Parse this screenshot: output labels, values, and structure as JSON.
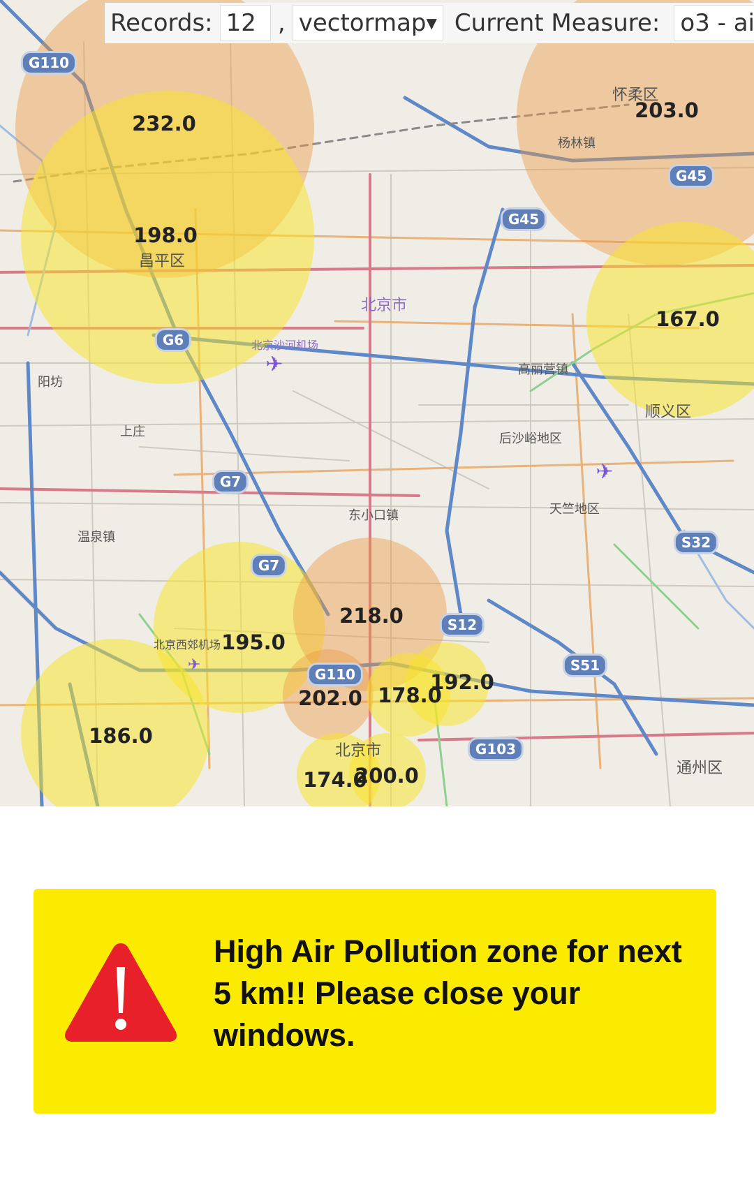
{
  "toolbar": {
    "records_label": "Records:",
    "records_value": "12",
    "separator": ",",
    "layer_selected": "vectormap",
    "measure_label": "Current Measure:",
    "measure_value": "o3 - ai"
  },
  "map": {
    "zones": [
      {
        "value": "232.0",
        "level": "orange",
        "color": "#ec9840"
      },
      {
        "value": "198.0",
        "level": "yellow",
        "color": "#f8e428"
      },
      {
        "value": "203.0",
        "level": "orange",
        "color": "#ec9840"
      },
      {
        "value": "167.0",
        "level": "yellow",
        "color": "#f8e428"
      },
      {
        "value": "218.0",
        "level": "orange",
        "color": "#ec9840"
      },
      {
        "value": "195.0",
        "level": "yellow",
        "color": "#f8e428"
      },
      {
        "value": "202.0",
        "level": "orange",
        "color": "#ec9840"
      },
      {
        "value": "178.0",
        "level": "yellow",
        "color": "#f8e428"
      },
      {
        "value": "192.0",
        "level": "yellow",
        "color": "#f8e428"
      },
      {
        "value": "186.0",
        "level": "yellow",
        "color": "#f8e428"
      },
      {
        "value": "174.0",
        "level": "yellow",
        "color": "#f8e428"
      },
      {
        "value": "200.0",
        "level": "yellow",
        "color": "#f8e428"
      }
    ],
    "road_shields": [
      "G110",
      "G45",
      "G45",
      "G6",
      "G7",
      "G7",
      "S12",
      "S51",
      "S32",
      "G110",
      "G103"
    ],
    "places": [
      "怀柔区",
      "杨林镇",
      "北京市",
      "昌平区",
      "北京沙河机场",
      "阳坊",
      "上庄",
      "高丽营镇",
      "后沙峪地区",
      "顺义区",
      "东小口镇",
      "天竺地区",
      "温泉镇",
      "北京西郊机场",
      "北京市",
      "通州区"
    ],
    "airport_icon": "airplane-icon"
  },
  "alert": {
    "icon": "warning-triangle-icon",
    "icon_color": "#e8202a",
    "background": "#fbeb00",
    "message": "High Air Pollution zone for next 5 km!! Please close your windows."
  }
}
